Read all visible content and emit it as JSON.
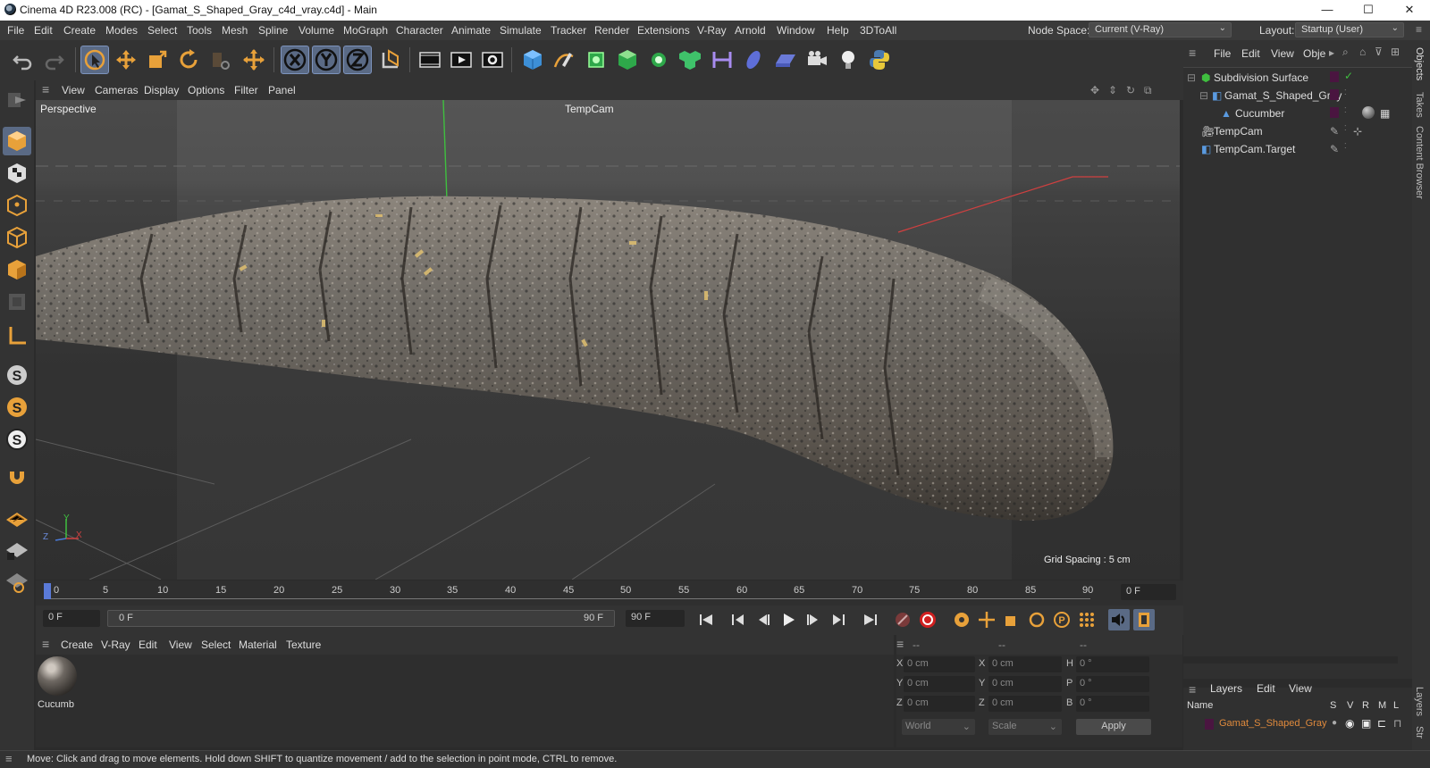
{
  "window": {
    "title": "Cinema 4D R23.008 (RC) - [Gamat_S_Shaped_Gray_c4d_vray.c4d] - Main",
    "minimize": "—",
    "maximize": "☐",
    "close": "✕"
  },
  "menu": [
    "File",
    "Edit",
    "Create",
    "Modes",
    "Select",
    "Tools",
    "Mesh",
    "Spline",
    "Volume",
    "MoGraph",
    "Character",
    "Animate",
    "Simulate",
    "Tracker",
    "Render",
    "Extensions",
    "V-Ray",
    "Arnold",
    "Window",
    "Help",
    "3DToAll"
  ],
  "node_space": {
    "label": "Node Space:",
    "value": "Current (V-Ray)"
  },
  "layout": {
    "label": "Layout:",
    "value": "Startup (User)"
  },
  "viewport_menu": [
    "View",
    "Cameras",
    "Display",
    "Options",
    "Filter",
    "Panel"
  ],
  "viewport": {
    "name": "Perspective",
    "camera": "TempCam",
    "grid_spacing": "Grid Spacing : 5 cm",
    "axis_y": "Y",
    "axis_z": "Z",
    "axis_x": "X"
  },
  "timeline": {
    "ticks": [
      "0",
      "5",
      "10",
      "15",
      "20",
      "25",
      "30",
      "35",
      "40",
      "45",
      "50",
      "55",
      "60",
      "65",
      "70",
      "75",
      "80",
      "85",
      "90"
    ],
    "current_frame": "0 F"
  },
  "transport": {
    "start": "0 F",
    "range_start": "0 F",
    "range_end": "90 F",
    "end": "90 F"
  },
  "objects_menu": [
    "File",
    "Edit",
    "View",
    "Obje"
  ],
  "objects": [
    {
      "name": "Subdivision Surface",
      "indent": 0
    },
    {
      "name": "Gamat_S_Shaped_Gray",
      "indent": 1
    },
    {
      "name": "Cucumber",
      "indent": 2
    },
    {
      "name": "TempCam",
      "indent": 0
    },
    {
      "name": "TempCam.Target",
      "indent": 0
    }
  ],
  "right_tabs": [
    "Objects",
    "Takes",
    "Content Browser",
    "Layers",
    "Str"
  ],
  "material_menu": [
    "Create",
    "V-Ray",
    "Edit",
    "View",
    "Select",
    "Material",
    "Texture"
  ],
  "material": {
    "name": "Cucumb"
  },
  "coords": {
    "headers": [
      "--",
      "--",
      "--"
    ],
    "rows": [
      {
        "a": "X",
        "av": "0 cm",
        "b": "X",
        "bv": "0 cm",
        "c": "H",
        "cv": "0 °"
      },
      {
        "a": "Y",
        "av": "0 cm",
        "b": "Y",
        "bv": "0 cm",
        "c": "P",
        "cv": "0 °"
      },
      {
        "a": "Z",
        "av": "0 cm",
        "b": "Z",
        "bv": "0 cm",
        "c": "B",
        "cv": "0 °"
      }
    ],
    "space": "World",
    "mode": "Scale",
    "apply": "Apply"
  },
  "layers": {
    "menu": [
      "Layers",
      "Edit",
      "View"
    ],
    "header": {
      "name": "Name",
      "cols": [
        "S",
        "V",
        "R",
        "M",
        "L"
      ]
    },
    "items": [
      {
        "name": "Gamat_S_Shaped_Gray"
      }
    ]
  },
  "status": "Move: Click and drag to move elements. Hold down SHIFT to quantize movement / add to the selection in point mode, CTRL to remove.",
  "colors": {
    "accent_blue": "#5a6a85",
    "layer_name": "#e08a3c",
    "axis_green": "#3fbf3f",
    "axis_red": "#d04040"
  }
}
